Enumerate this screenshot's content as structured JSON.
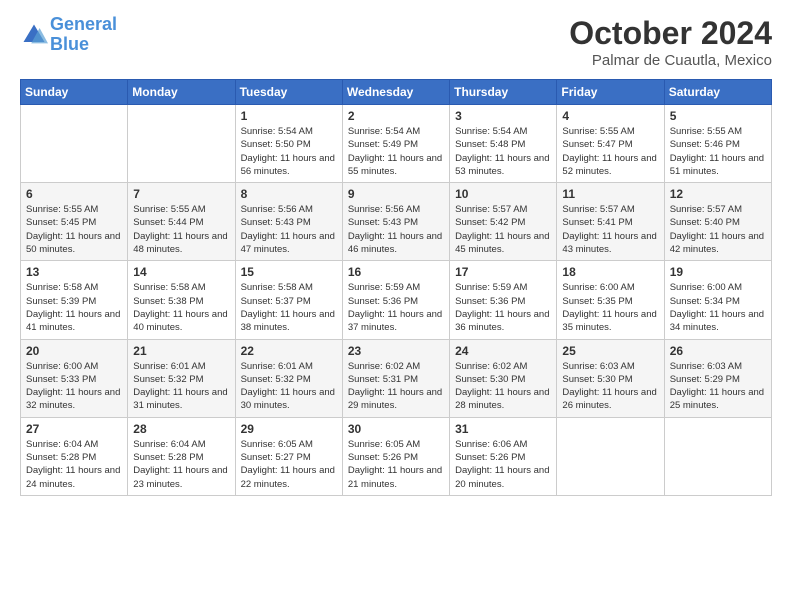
{
  "header": {
    "logo_line1": "General",
    "logo_line2": "Blue",
    "month": "October 2024",
    "location": "Palmar de Cuautla, Mexico"
  },
  "weekdays": [
    "Sunday",
    "Monday",
    "Tuesday",
    "Wednesday",
    "Thursday",
    "Friday",
    "Saturday"
  ],
  "weeks": [
    [
      {
        "day": "",
        "info": ""
      },
      {
        "day": "",
        "info": ""
      },
      {
        "day": "1",
        "info": "Sunrise: 5:54 AM\nSunset: 5:50 PM\nDaylight: 11 hours and 56 minutes."
      },
      {
        "day": "2",
        "info": "Sunrise: 5:54 AM\nSunset: 5:49 PM\nDaylight: 11 hours and 55 minutes."
      },
      {
        "day": "3",
        "info": "Sunrise: 5:54 AM\nSunset: 5:48 PM\nDaylight: 11 hours and 53 minutes."
      },
      {
        "day": "4",
        "info": "Sunrise: 5:55 AM\nSunset: 5:47 PM\nDaylight: 11 hours and 52 minutes."
      },
      {
        "day": "5",
        "info": "Sunrise: 5:55 AM\nSunset: 5:46 PM\nDaylight: 11 hours and 51 minutes."
      }
    ],
    [
      {
        "day": "6",
        "info": "Sunrise: 5:55 AM\nSunset: 5:45 PM\nDaylight: 11 hours and 50 minutes."
      },
      {
        "day": "7",
        "info": "Sunrise: 5:55 AM\nSunset: 5:44 PM\nDaylight: 11 hours and 48 minutes."
      },
      {
        "day": "8",
        "info": "Sunrise: 5:56 AM\nSunset: 5:43 PM\nDaylight: 11 hours and 47 minutes."
      },
      {
        "day": "9",
        "info": "Sunrise: 5:56 AM\nSunset: 5:43 PM\nDaylight: 11 hours and 46 minutes."
      },
      {
        "day": "10",
        "info": "Sunrise: 5:57 AM\nSunset: 5:42 PM\nDaylight: 11 hours and 45 minutes."
      },
      {
        "day": "11",
        "info": "Sunrise: 5:57 AM\nSunset: 5:41 PM\nDaylight: 11 hours and 43 minutes."
      },
      {
        "day": "12",
        "info": "Sunrise: 5:57 AM\nSunset: 5:40 PM\nDaylight: 11 hours and 42 minutes."
      }
    ],
    [
      {
        "day": "13",
        "info": "Sunrise: 5:58 AM\nSunset: 5:39 PM\nDaylight: 11 hours and 41 minutes."
      },
      {
        "day": "14",
        "info": "Sunrise: 5:58 AM\nSunset: 5:38 PM\nDaylight: 11 hours and 40 minutes."
      },
      {
        "day": "15",
        "info": "Sunrise: 5:58 AM\nSunset: 5:37 PM\nDaylight: 11 hours and 38 minutes."
      },
      {
        "day": "16",
        "info": "Sunrise: 5:59 AM\nSunset: 5:36 PM\nDaylight: 11 hours and 37 minutes."
      },
      {
        "day": "17",
        "info": "Sunrise: 5:59 AM\nSunset: 5:36 PM\nDaylight: 11 hours and 36 minutes."
      },
      {
        "day": "18",
        "info": "Sunrise: 6:00 AM\nSunset: 5:35 PM\nDaylight: 11 hours and 35 minutes."
      },
      {
        "day": "19",
        "info": "Sunrise: 6:00 AM\nSunset: 5:34 PM\nDaylight: 11 hours and 34 minutes."
      }
    ],
    [
      {
        "day": "20",
        "info": "Sunrise: 6:00 AM\nSunset: 5:33 PM\nDaylight: 11 hours and 32 minutes."
      },
      {
        "day": "21",
        "info": "Sunrise: 6:01 AM\nSunset: 5:32 PM\nDaylight: 11 hours and 31 minutes."
      },
      {
        "day": "22",
        "info": "Sunrise: 6:01 AM\nSunset: 5:32 PM\nDaylight: 11 hours and 30 minutes."
      },
      {
        "day": "23",
        "info": "Sunrise: 6:02 AM\nSunset: 5:31 PM\nDaylight: 11 hours and 29 minutes."
      },
      {
        "day": "24",
        "info": "Sunrise: 6:02 AM\nSunset: 5:30 PM\nDaylight: 11 hours and 28 minutes."
      },
      {
        "day": "25",
        "info": "Sunrise: 6:03 AM\nSunset: 5:30 PM\nDaylight: 11 hours and 26 minutes."
      },
      {
        "day": "26",
        "info": "Sunrise: 6:03 AM\nSunset: 5:29 PM\nDaylight: 11 hours and 25 minutes."
      }
    ],
    [
      {
        "day": "27",
        "info": "Sunrise: 6:04 AM\nSunset: 5:28 PM\nDaylight: 11 hours and 24 minutes."
      },
      {
        "day": "28",
        "info": "Sunrise: 6:04 AM\nSunset: 5:28 PM\nDaylight: 11 hours and 23 minutes."
      },
      {
        "day": "29",
        "info": "Sunrise: 6:05 AM\nSunset: 5:27 PM\nDaylight: 11 hours and 22 minutes."
      },
      {
        "day": "30",
        "info": "Sunrise: 6:05 AM\nSunset: 5:26 PM\nDaylight: 11 hours and 21 minutes."
      },
      {
        "day": "31",
        "info": "Sunrise: 6:06 AM\nSunset: 5:26 PM\nDaylight: 11 hours and 20 minutes."
      },
      {
        "day": "",
        "info": ""
      },
      {
        "day": "",
        "info": ""
      }
    ]
  ]
}
